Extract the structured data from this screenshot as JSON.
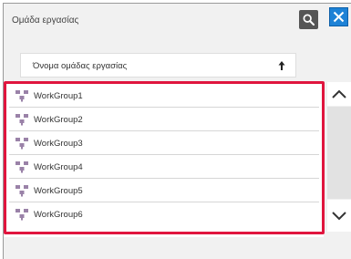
{
  "dialog": {
    "title": "Ομάδα εργασίας"
  },
  "header": {
    "search_icon": "search-icon",
    "close_icon": "close-icon",
    "close_color": "#1e82d6"
  },
  "sort_column": {
    "label": "Όνομα ομάδας εργασίας",
    "sort_icon": "sort-ascending-icon"
  },
  "workgroups": [
    {
      "label": "WorkGroup1",
      "icon": "workgroup-icon"
    },
    {
      "label": "WorkGroup2",
      "icon": "workgroup-icon"
    },
    {
      "label": "WorkGroup3",
      "icon": "workgroup-icon"
    },
    {
      "label": "WorkGroup4",
      "icon": "workgroup-icon"
    },
    {
      "label": "WorkGroup5",
      "icon": "workgroup-icon"
    },
    {
      "label": "WorkGroup6",
      "icon": "workgroup-icon"
    }
  ],
  "highlight_color": "#e0153e",
  "scroll": {
    "up_icon": "chevron-up-icon",
    "down_icon": "chevron-down-icon"
  }
}
